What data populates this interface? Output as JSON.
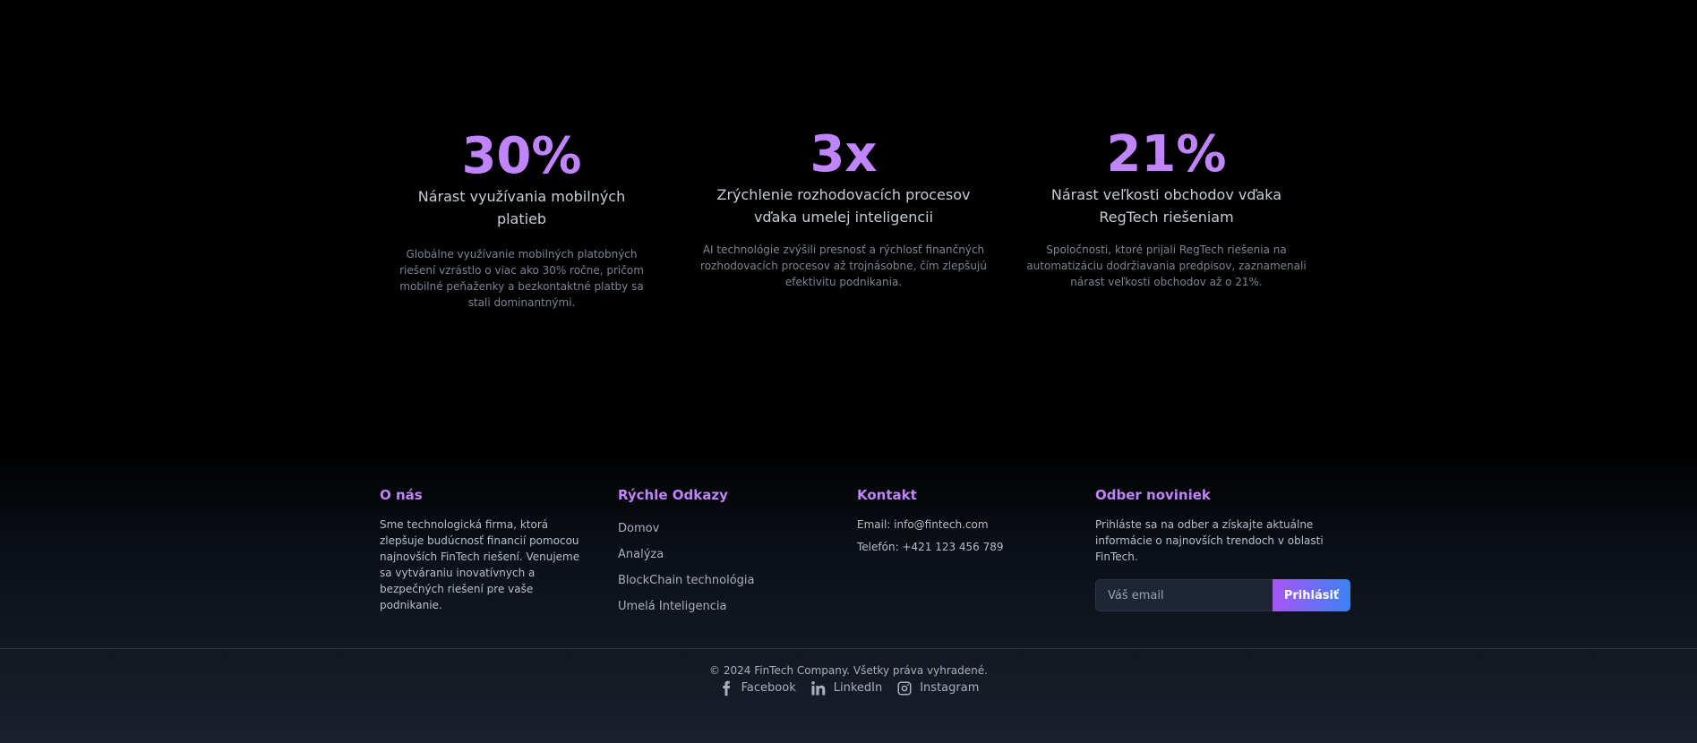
{
  "stats": [
    {
      "value": "30%",
      "title": "Nárast využívania mobilných platieb",
      "description": "Globálne využívanie mobilných platobných riešení vzrástlo o viac ako 30% ročne, pričom mobilné peňaženky a bezkontaktné platby sa stali dominantnými."
    },
    {
      "value": "3x",
      "title": "Zrýchlenie rozhodovacích procesov vďaka umelej inteligencii",
      "description": "AI technológie zvýšili presnosť a rýchlosť finančných rozhodovacích procesov až trojnásobne, čím zlepšujú efektivitu podnikania."
    },
    {
      "value": "21%",
      "title": "Nárast veľkosti obchodov vďaka RegTech riešeniam",
      "description": "Spoločnosti, ktoré prijali RegTech riešenia na automatizáciu dodržiavania predpisov, zaznamenali nárast veľkosti obchodov až o 21%."
    }
  ],
  "footer": {
    "about": {
      "heading": "O nás",
      "text": "Sme technologická firma, ktorá zlepšuje budúcnosť financií pomocou najnovších FinTech riešení. Venujeme sa vytváraniu inovatívnych a bezpečných riešení pre vaše podnikanie."
    },
    "links": {
      "heading": "Rýchle Odkazy",
      "items": [
        "Domov",
        "Analýza",
        "BlockChain technológia",
        "Umelá Inteligencia"
      ]
    },
    "contact": {
      "heading": "Kontakt",
      "email": "Email: info@fintech.com",
      "phone": "Telefón: +421 123 456 789"
    },
    "newsletter": {
      "heading": "Odber noviniek",
      "text": "Prihláste sa na odber a získajte aktuálne informácie o najnovších trendoch v oblasti FinTech.",
      "placeholder": "Váš email",
      "button": "Prihlásiť"
    },
    "copyright": "© 2024 FinTech Company. Všetky práva vyhradené.",
    "socials": [
      {
        "label": "Facebook",
        "icon": "facebook-icon"
      },
      {
        "label": "LinkedIn",
        "icon": "linkedin-icon"
      },
      {
        "label": "Instagram",
        "icon": "instagram-icon"
      }
    ]
  },
  "colors": {
    "accent": "#c084fc",
    "background": "#000000",
    "button_gradient_start": "#a855f7",
    "button_gradient_end": "#3b82f6"
  }
}
